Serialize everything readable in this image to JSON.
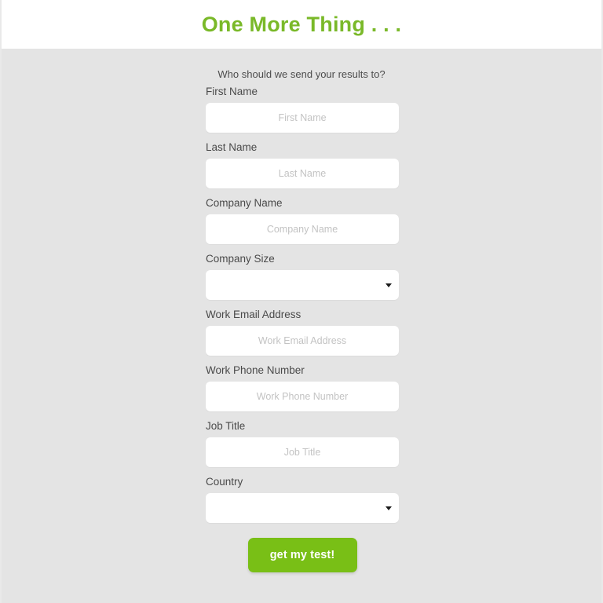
{
  "header": {
    "title": "One More Thing . . .",
    "title_color": "#7ab929",
    "background_color": "#ffffff"
  },
  "page": {
    "background_color": "#e4e4e4"
  },
  "form": {
    "subtitle": "Who should we send your results to?",
    "fields": [
      {
        "label": "First Name",
        "type": "text",
        "placeholder": "First Name",
        "value": "",
        "name": "first-name"
      },
      {
        "label": "Last Name",
        "type": "text",
        "placeholder": "Last Name",
        "value": "",
        "name": "last-name"
      },
      {
        "label": "Company Name",
        "type": "text",
        "placeholder": "Company Name",
        "value": "",
        "name": "company-name"
      },
      {
        "label": "Company Size",
        "type": "select",
        "placeholder": "",
        "value": "",
        "name": "company-size"
      },
      {
        "label": "Work Email Address",
        "type": "text",
        "placeholder": "Work Email Address",
        "value": "",
        "name": "work-email-address"
      },
      {
        "label": "Work Phone Number",
        "type": "text",
        "placeholder": "Work Phone Number",
        "value": "",
        "name": "work-phone-number"
      },
      {
        "label": "Job Title",
        "type": "text",
        "placeholder": "Job Title",
        "value": "",
        "name": "job-title"
      },
      {
        "label": "Country",
        "type": "select",
        "placeholder": "",
        "value": "",
        "name": "country"
      }
    ],
    "submit_label": "get my test!",
    "submit_color": "#79bf16",
    "icons": {
      "dropdown": "chevron-down-icon"
    }
  }
}
